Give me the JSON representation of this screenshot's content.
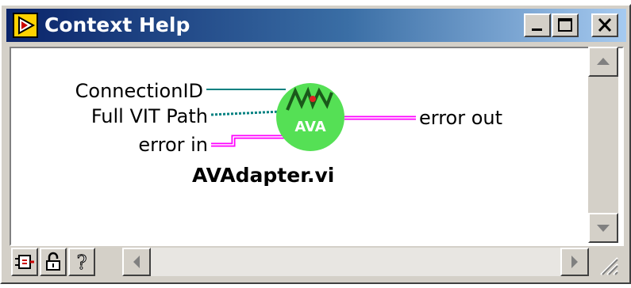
{
  "window": {
    "title": "Context Help",
    "controls": {
      "minimize": "minimize",
      "maximize": "maximize",
      "close": "close"
    }
  },
  "diagram": {
    "inputs": [
      "ConnectionID",
      "Full VIT Path",
      "error in"
    ],
    "outputs": [
      "error out"
    ],
    "vi_icon_label": "AVA",
    "vi_name": "AVAdapter.vi"
  },
  "toolbar": {
    "buttons": [
      "show-optional-terminals-icon",
      "lock-icon",
      "help-question-icon"
    ]
  },
  "colors": {
    "title_start": "#0a246a",
    "title_end": "#a6caf0",
    "wire_refnum": "#008080",
    "wire_path": "#008080",
    "wire_error": "#ff00ff",
    "vi_icon_fill": "#55e055"
  }
}
